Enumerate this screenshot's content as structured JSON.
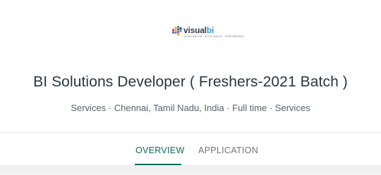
{
  "company": {
    "logo_word_part1": "visual",
    "logo_word_part2": "bi",
    "logo_tagline": "VISUALIZATION · INTELLIGENCE · PERFORMANCE",
    "logo_colors": [
      "#e84c6f",
      "#f7a928",
      "#8bc34a",
      "#2f9bd6",
      "#7b4fa3",
      "#3b3b52"
    ]
  },
  "job": {
    "title": "BI Solutions Developer ( Freshers-2021 Batch )",
    "meta": "Services · Chennai, Tamil Nadu, India · Full time · Services"
  },
  "tabs": [
    {
      "label": "OVERVIEW",
      "active": true
    },
    {
      "label": "APPLICATION",
      "active": false
    }
  ],
  "colors": {
    "accent": "#0f6b5c",
    "title": "#2c3440",
    "meta": "#59606a",
    "tab_inactive": "#6f7680"
  }
}
